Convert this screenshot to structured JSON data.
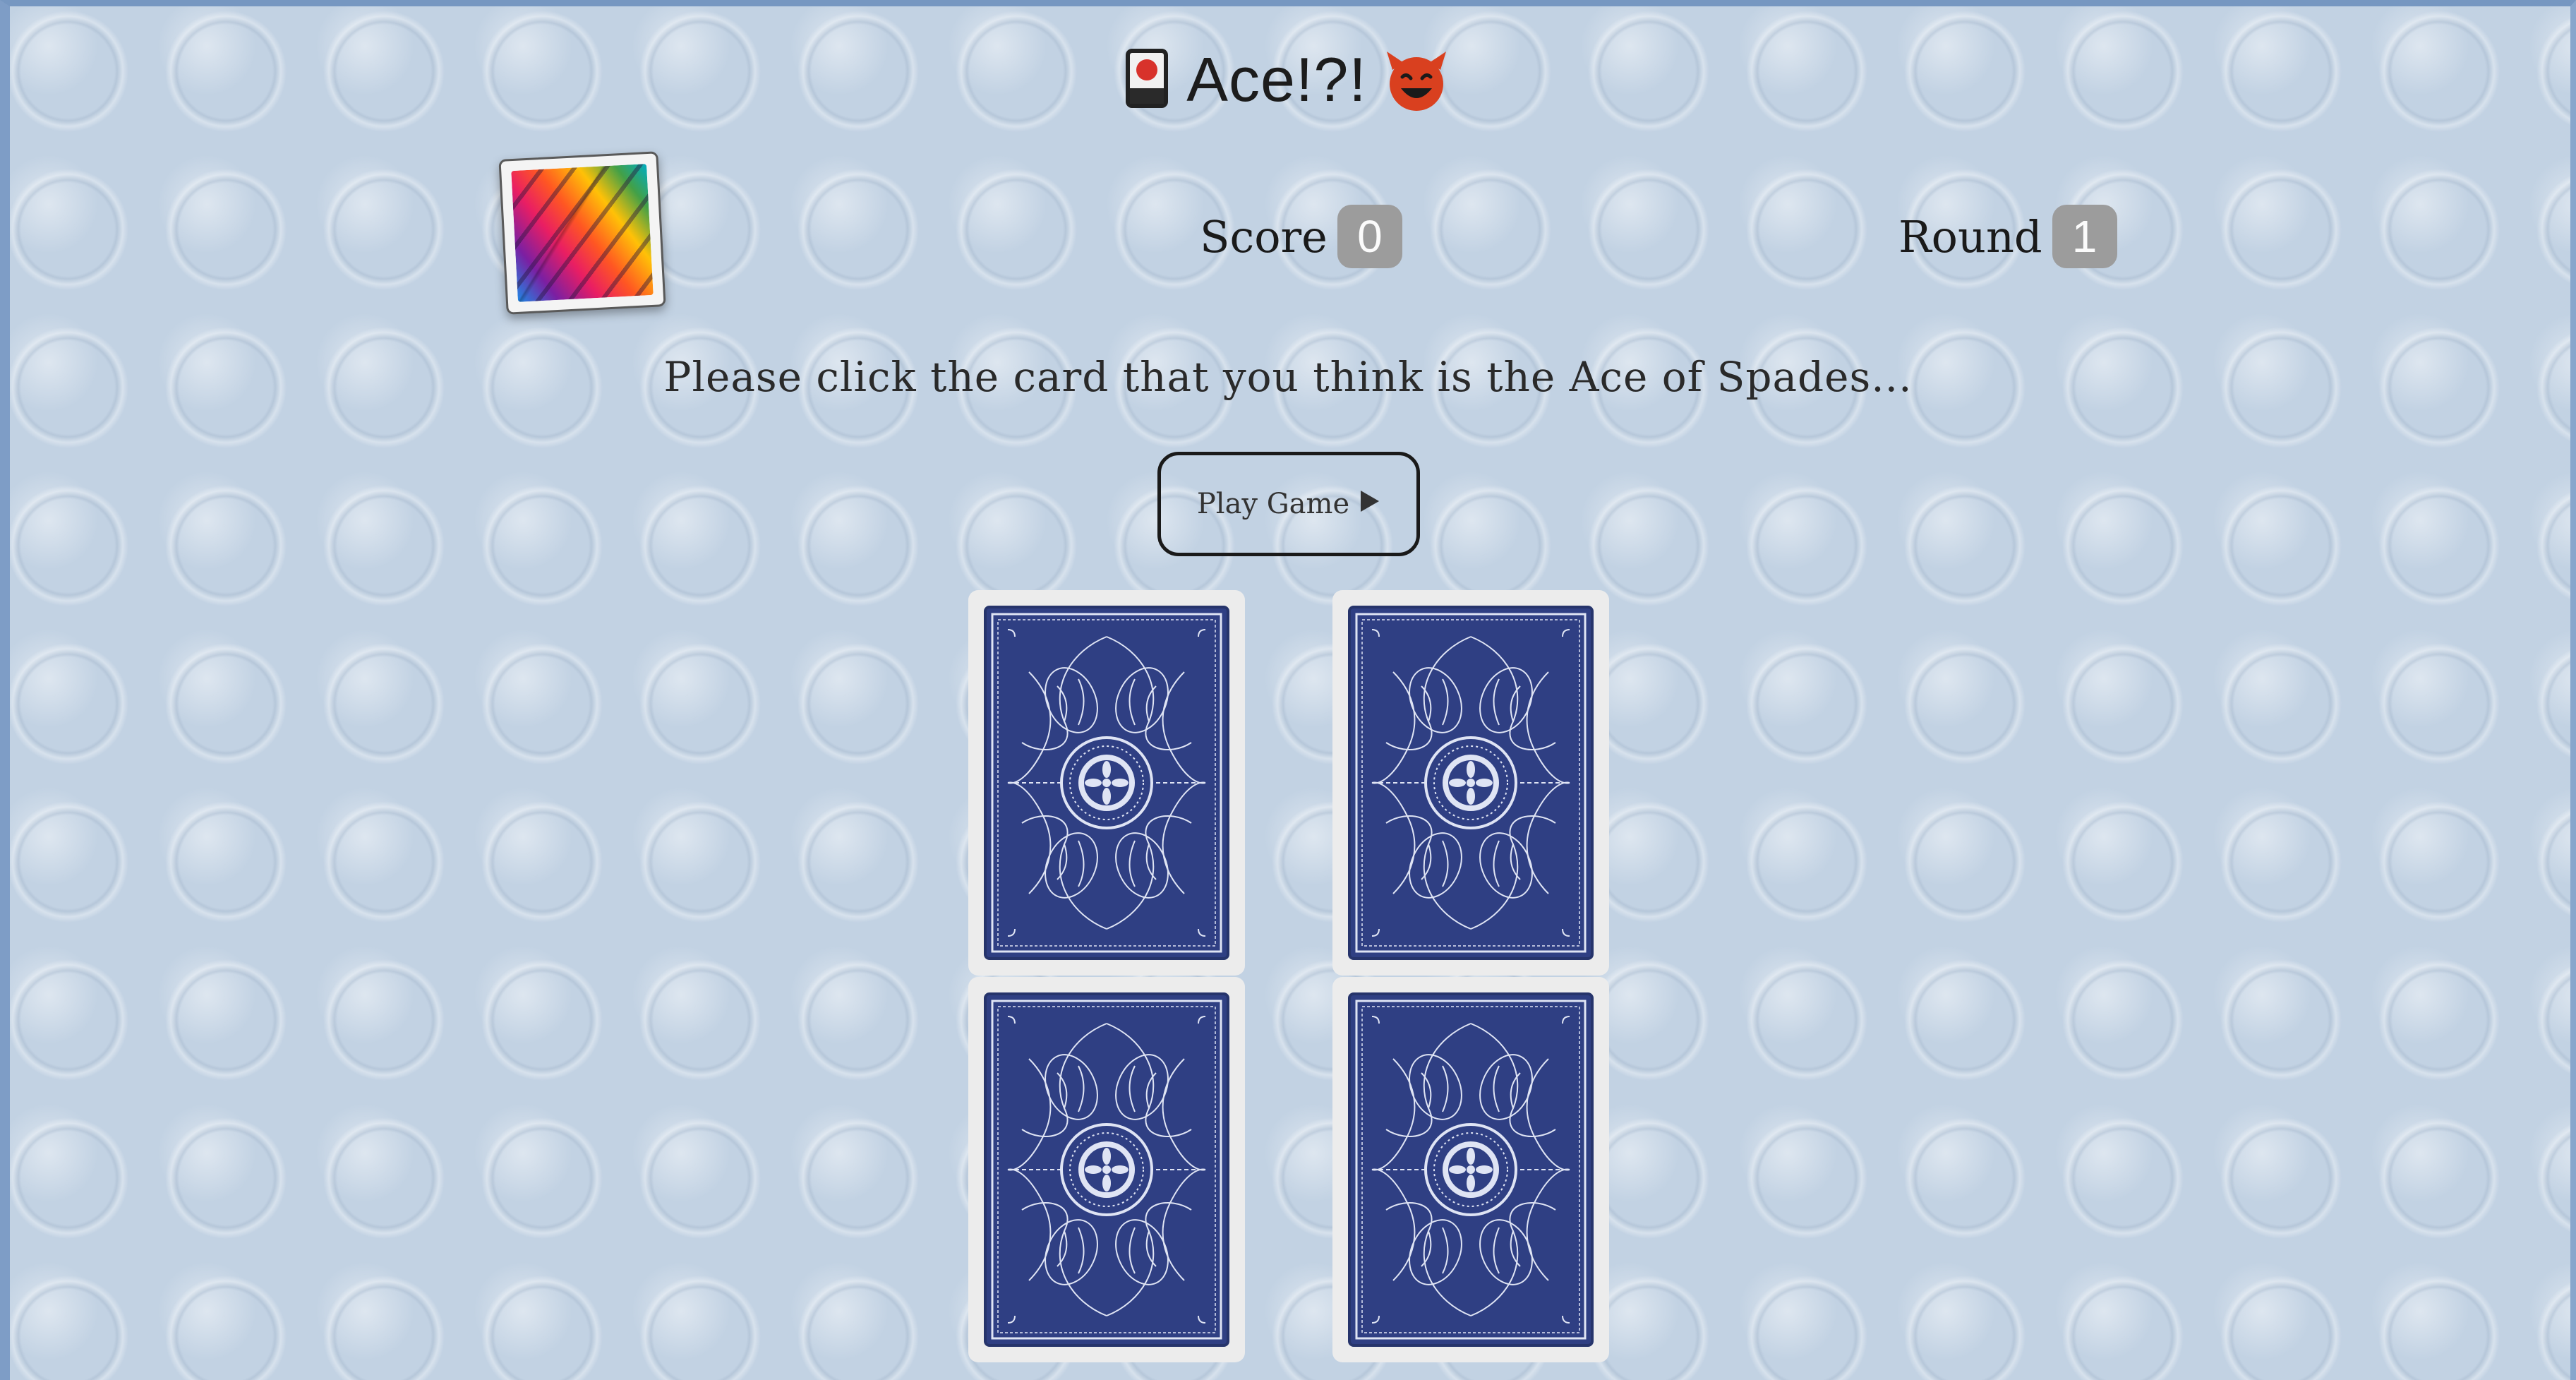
{
  "header": {
    "title": "Ace!?!",
    "card_icon": "playing-card-icon",
    "devil_icon": "smiling-devil-icon"
  },
  "thumbnail": {
    "icon": "colorful-cards-image"
  },
  "stats": {
    "score_label": "Score",
    "score_value": "0",
    "round_label": "Round",
    "round_value": "1"
  },
  "instruction": "Please click the card that you think is the Ace of Spades...",
  "play_button": {
    "label": "Play Game",
    "icon": "play-triangle-icon"
  },
  "cards": [
    {
      "name": "card-1",
      "face": "back"
    },
    {
      "name": "card-2",
      "face": "back"
    },
    {
      "name": "card-3",
      "face": "back"
    },
    {
      "name": "card-4",
      "face": "back"
    }
  ],
  "colors": {
    "background": "#c3d3e4",
    "card_back": "#2f3f83",
    "badge": "#9c9c9c",
    "devil": "#d9401f"
  }
}
